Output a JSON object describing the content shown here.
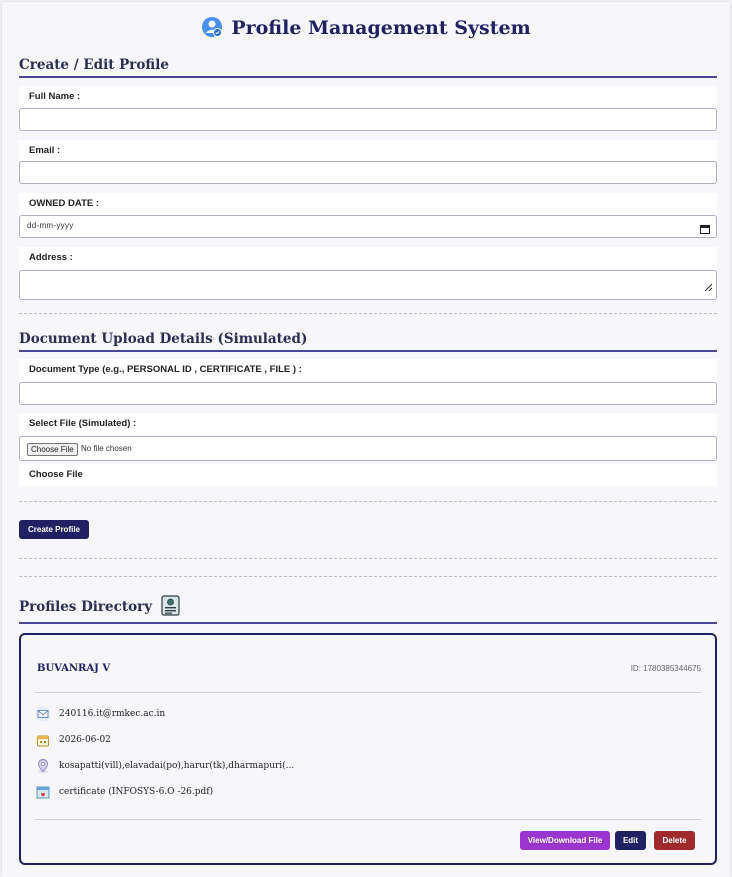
{
  "app": {
    "title": "Profile Management System"
  },
  "sections": {
    "create_edit": "Create / Edit Profile",
    "document_upload": "Document Upload Details (Simulated)",
    "directory": "Profiles Directory"
  },
  "form": {
    "full_name_label": "Full Name :",
    "email_label": "Email :",
    "owned_date_label": "OWNED DATE :",
    "owned_date_placeholder": "dd-mm-yyyy",
    "address_label": "Address :",
    "doc_type_label": "Document Type (e.g., PERSONAL ID , CERTIFICATE , FILE ) :",
    "select_file_label": "Select File (Simulated) :",
    "choose_file_button": "Choose File",
    "no_file_text": "No file chosen",
    "choose_file_caption": "Choose File",
    "create_button": "Create Profile"
  },
  "profile": {
    "name": "BUVANRAJ V",
    "id_text": "ID: 1780385344675",
    "email": "240116.it@rmkec.ac.in",
    "date": "2026-06-02",
    "address": "kosapatti(vill),elavadai(po),harur(tk),dharmapuri(...",
    "document": "certificate (INFOSYS-6.O -26.pdf)",
    "view_button": "View/Download File",
    "edit_button": "Edit",
    "delete_button": "Delete"
  },
  "colors": {
    "primary": "#1f2163",
    "purple": "#9b35d0",
    "danger": "#9f2b2d",
    "accent_line": "#4b4696"
  }
}
